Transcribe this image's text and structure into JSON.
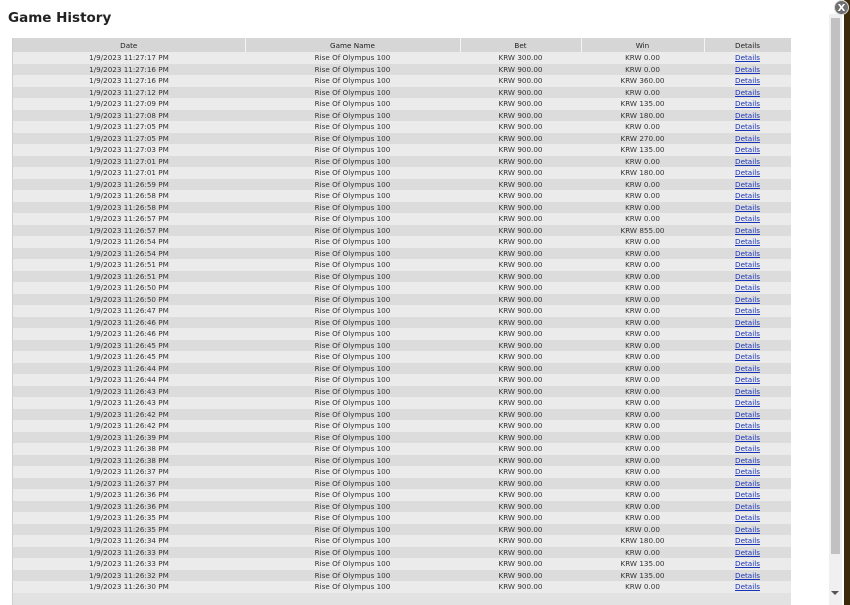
{
  "dialog": {
    "title": "Game History",
    "close_label": "X"
  },
  "columns": [
    "Date",
    "Game Name",
    "Bet",
    "Win",
    "Details"
  ],
  "rows": [
    [
      "1/9/2023 11:27:17 PM",
      "Rise Of Olympus 100",
      "KRW 300.00",
      "KRW 0.00",
      "Details"
    ],
    [
      "1/9/2023 11:27:16 PM",
      "Rise Of Olympus 100",
      "KRW 900.00",
      "KRW 0.00",
      "Details"
    ],
    [
      "1/9/2023 11:27:16 PM",
      "Rise Of Olympus 100",
      "KRW 900.00",
      "KRW 360.00",
      "Details"
    ],
    [
      "1/9/2023 11:27:12 PM",
      "Rise Of Olympus 100",
      "KRW 900.00",
      "KRW 0.00",
      "Details"
    ],
    [
      "1/9/2023 11:27:09 PM",
      "Rise Of Olympus 100",
      "KRW 900.00",
      "KRW 135.00",
      "Details"
    ],
    [
      "1/9/2023 11:27:08 PM",
      "Rise Of Olympus 100",
      "KRW 900.00",
      "KRW 180.00",
      "Details"
    ],
    [
      "1/9/2023 11:27:05 PM",
      "Rise Of Olympus 100",
      "KRW 900.00",
      "KRW 0.00",
      "Details"
    ],
    [
      "1/9/2023 11:27:05 PM",
      "Rise Of Olympus 100",
      "KRW 900.00",
      "KRW 270.00",
      "Details"
    ],
    [
      "1/9/2023 11:27:03 PM",
      "Rise Of Olympus 100",
      "KRW 900.00",
      "KRW 135.00",
      "Details"
    ],
    [
      "1/9/2023 11:27:01 PM",
      "Rise Of Olympus 100",
      "KRW 900.00",
      "KRW 0.00",
      "Details"
    ],
    [
      "1/9/2023 11:27:01 PM",
      "Rise Of Olympus 100",
      "KRW 900.00",
      "KRW 180.00",
      "Details"
    ],
    [
      "1/9/2023 11:26:59 PM",
      "Rise Of Olympus 100",
      "KRW 900.00",
      "KRW 0.00",
      "Details"
    ],
    [
      "1/9/2023 11:26:58 PM",
      "Rise Of Olympus 100",
      "KRW 900.00",
      "KRW 0.00",
      "Details"
    ],
    [
      "1/9/2023 11:26:58 PM",
      "Rise Of Olympus 100",
      "KRW 900.00",
      "KRW 0.00",
      "Details"
    ],
    [
      "1/9/2023 11:26:57 PM",
      "Rise Of Olympus 100",
      "KRW 900.00",
      "KRW 0.00",
      "Details"
    ],
    [
      "1/9/2023 11:26:57 PM",
      "Rise Of Olympus 100",
      "KRW 900.00",
      "KRW 855.00",
      "Details"
    ],
    [
      "1/9/2023 11:26:54 PM",
      "Rise Of Olympus 100",
      "KRW 900.00",
      "KRW 0.00",
      "Details"
    ],
    [
      "1/9/2023 11:26:54 PM",
      "Rise Of Olympus 100",
      "KRW 900.00",
      "KRW 0.00",
      "Details"
    ],
    [
      "1/9/2023 11:26:51 PM",
      "Rise Of Olympus 100",
      "KRW 900.00",
      "KRW 0.00",
      "Details"
    ],
    [
      "1/9/2023 11:26:51 PM",
      "Rise Of Olympus 100",
      "KRW 900.00",
      "KRW 0.00",
      "Details"
    ],
    [
      "1/9/2023 11:26:50 PM",
      "Rise Of Olympus 100",
      "KRW 900.00",
      "KRW 0.00",
      "Details"
    ],
    [
      "1/9/2023 11:26:50 PM",
      "Rise Of Olympus 100",
      "KRW 900.00",
      "KRW 0.00",
      "Details"
    ],
    [
      "1/9/2023 11:26:47 PM",
      "Rise Of Olympus 100",
      "KRW 900.00",
      "KRW 0.00",
      "Details"
    ],
    [
      "1/9/2023 11:26:46 PM",
      "Rise Of Olympus 100",
      "KRW 900.00",
      "KRW 0.00",
      "Details"
    ],
    [
      "1/9/2023 11:26:46 PM",
      "Rise Of Olympus 100",
      "KRW 900.00",
      "KRW 0.00",
      "Details"
    ],
    [
      "1/9/2023 11:26:45 PM",
      "Rise Of Olympus 100",
      "KRW 900.00",
      "KRW 0.00",
      "Details"
    ],
    [
      "1/9/2023 11:26:45 PM",
      "Rise Of Olympus 100",
      "KRW 900.00",
      "KRW 0.00",
      "Details"
    ],
    [
      "1/9/2023 11:26:44 PM",
      "Rise Of Olympus 100",
      "KRW 900.00",
      "KRW 0.00",
      "Details"
    ],
    [
      "1/9/2023 11:26:44 PM",
      "Rise Of Olympus 100",
      "KRW 900.00",
      "KRW 0.00",
      "Details"
    ],
    [
      "1/9/2023 11:26:43 PM",
      "Rise Of Olympus 100",
      "KRW 900.00",
      "KRW 0.00",
      "Details"
    ],
    [
      "1/9/2023 11:26:43 PM",
      "Rise Of Olympus 100",
      "KRW 900.00",
      "KRW 0.00",
      "Details"
    ],
    [
      "1/9/2023 11:26:42 PM",
      "Rise Of Olympus 100",
      "KRW 900.00",
      "KRW 0.00",
      "Details"
    ],
    [
      "1/9/2023 11:26:42 PM",
      "Rise Of Olympus 100",
      "KRW 900.00",
      "KRW 0.00",
      "Details"
    ],
    [
      "1/9/2023 11:26:39 PM",
      "Rise Of Olympus 100",
      "KRW 900.00",
      "KRW 0.00",
      "Details"
    ],
    [
      "1/9/2023 11:26:38 PM",
      "Rise Of Olympus 100",
      "KRW 900.00",
      "KRW 0.00",
      "Details"
    ],
    [
      "1/9/2023 11:26:38 PM",
      "Rise Of Olympus 100",
      "KRW 900.00",
      "KRW 0.00",
      "Details"
    ],
    [
      "1/9/2023 11:26:37 PM",
      "Rise Of Olympus 100",
      "KRW 900.00",
      "KRW 0.00",
      "Details"
    ],
    [
      "1/9/2023 11:26:37 PM",
      "Rise Of Olympus 100",
      "KRW 900.00",
      "KRW 0.00",
      "Details"
    ],
    [
      "1/9/2023 11:26:36 PM",
      "Rise Of Olympus 100",
      "KRW 900.00",
      "KRW 0.00",
      "Details"
    ],
    [
      "1/9/2023 11:26:36 PM",
      "Rise Of Olympus 100",
      "KRW 900.00",
      "KRW 0.00",
      "Details"
    ],
    [
      "1/9/2023 11:26:35 PM",
      "Rise Of Olympus 100",
      "KRW 900.00",
      "KRW 0.00",
      "Details"
    ],
    [
      "1/9/2023 11:26:35 PM",
      "Rise Of Olympus 100",
      "KRW 900.00",
      "KRW 0.00",
      "Details"
    ],
    [
      "1/9/2023 11:26:34 PM",
      "Rise Of Olympus 100",
      "KRW 900.00",
      "KRW 180.00",
      "Details"
    ],
    [
      "1/9/2023 11:26:33 PM",
      "Rise Of Olympus 100",
      "KRW 900.00",
      "KRW 0.00",
      "Details"
    ],
    [
      "1/9/2023 11:26:33 PM",
      "Rise Of Olympus 100",
      "KRW 900.00",
      "KRW 135.00",
      "Details"
    ],
    [
      "1/9/2023 11:26:32 PM",
      "Rise Of Olympus 100",
      "KRW 900.00",
      "KRW 135.00",
      "Details"
    ],
    [
      "1/9/2023 11:26:30 PM",
      "Rise Of Olympus 100",
      "KRW 900.00",
      "KRW 0.00",
      "Details"
    ]
  ],
  "colors": {
    "link": "#1a34b8",
    "header_bg": "#d6d6d6"
  }
}
